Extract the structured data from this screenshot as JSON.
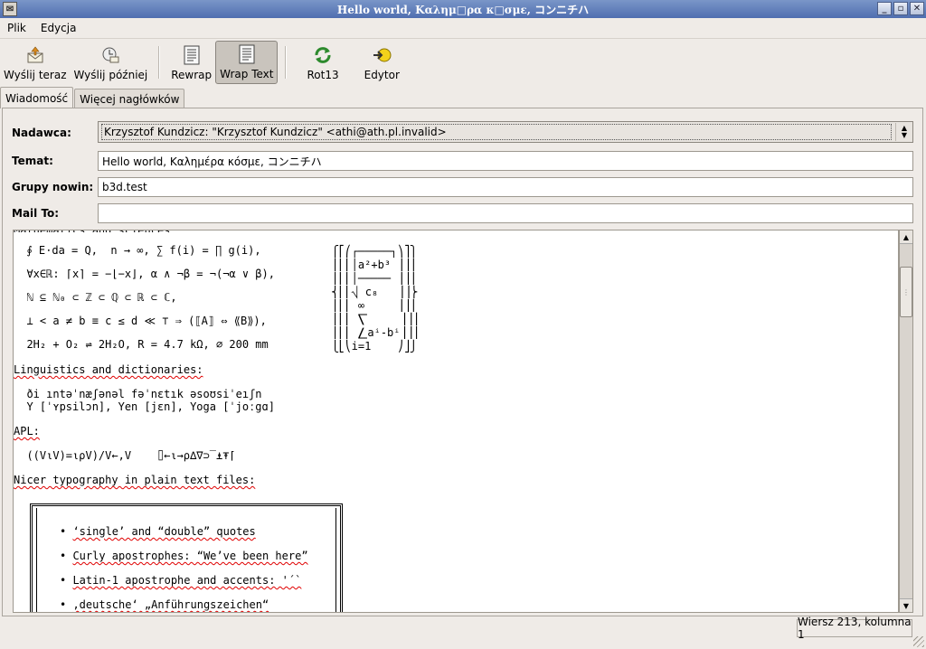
{
  "window": {
    "title": "Hello world, Καλημ□ρα κ□σμε, コンニチハ",
    "buttons": [
      "_",
      "▫",
      "✕"
    ]
  },
  "menu": {
    "file": "Plik",
    "edit": "Edycja"
  },
  "toolbar": {
    "send_now": "Wyślij teraz",
    "send_later": "Wyślij później",
    "rewrap": "Rewrap",
    "wrap_text": "Wrap Text",
    "rot13": "Rot13",
    "editor": "Edytor"
  },
  "tabs": {
    "message": "Wiadomość",
    "more_headers": "Więcej nagłówków"
  },
  "form": {
    "sender_label": "Nadawca:",
    "sender_value": "Krzysztof Kundzicz: \"Krzysztof Kundzicz\" <athi@ath.pl.invalid>",
    "subject_label": "Temat:",
    "subject_value": "Hello world, Καλημέρα κόσμε, コンニチハ",
    "newsgroups_label": "Grupy nowin:",
    "newsgroups_value": "b3d.test",
    "mailto_label": "Mail To:",
    "mailto_value": ""
  },
  "body": {
    "math_lines": [
      "  ∮ E⋅da = Q,  n → ∞, ∑ f(i) = ∏ g(i),",
      "  ∀x∈ℝ: ⌈x⌉ = −⌊−x⌋, α ∧ ¬β = ¬(¬α ∨ β),",
      "  ℕ ⊆ ℕ₀ ⊂ ℤ ⊂ ℚ ⊂ ℝ ⊂ ℂ,",
      "  ⊥ < a ≠ b ≡ c ≤ d ≪ ⊤ ⇒ (⟦A⟧ ⇔ ⟪B⟫),",
      "  2H₂ + O₂ ⇌ 2H₂O, R = 4.7 kΩ, ⌀ 200 mm"
    ],
    "formula_lines": [
      "⎧⎡⎛┌─────┐⎞⎤⎫",
      "⎪⎢⎜│a²+b³ ⎟⎥⎪",
      "⎪⎢⎜│───── ⎟⎥⎪",
      "⎨⎢⎜⎷ c₈   ⎟⎥⎬",
      "⎪⎢⎜ ∞     ⎟⎥⎪",
      "⎪⎢⎜ ⎲     ⎟⎥⎪",
      "⎪⎢⎜ ⎳aⁱ-bⁱ⎟⎥⎪",
      "⎩⎣⎝i=1    ⎠⎦⎭"
    ],
    "linguistics_heading": "Linguistics and dictionaries:",
    "ipa_line": "  ði ıntəˈnæʃənəl fəˈnɛtık əsoʊsiˈeıʃn",
    "ipa_line2": "  Y [ˈʏpsilɔn], Yen [jɛn], Yoga [ˈjoːgɑ]",
    "apl_heading": "APL:",
    "apl_line": "  ((V⍳V)=⍳⍴V)/V←,V    ⌷←⍳→⍴∆∇⊃‾⍎⍕⌈",
    "typography_heading": "Nicer typography in plain text files:",
    "box_items": [
      "‘single’ and “double” quotes",
      "Curly apostrophes: “We’ve been here”",
      "Latin-1 apostrophe and accents: '´`",
      "‚deutsche‘ „Anführungszeichen“"
    ]
  },
  "status": {
    "cursor": "Wiersz 213, kolumna 1"
  }
}
